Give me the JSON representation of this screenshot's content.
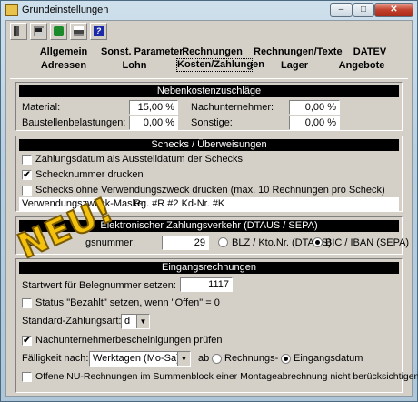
{
  "window": {
    "title": "Grundeinstellungen",
    "min_glyph": "–",
    "max_glyph": "□",
    "close_glyph": "✕"
  },
  "toolbar": {
    "icons": [
      "exit-icon",
      "save-icon",
      "refresh-icon",
      "print-icon",
      "help-icon"
    ],
    "help_glyph": "?"
  },
  "tabs": {
    "row1": [
      "Allgemein",
      "Sonst. Parameter",
      "Rechnungen",
      "Rechnungen/Texte",
      "DATEV"
    ],
    "row2": [
      "Adressen",
      "Lohn",
      "Kosten/Zahlungen",
      "Lager",
      "Angebote"
    ],
    "active": "Kosten/Zahlungen"
  },
  "nebenkosten": {
    "header": "Nebenkostenzuschläge",
    "material_label": "Material:",
    "material_value": "15,00 %",
    "nachunternehmer_label": "Nachunternehmer:",
    "nachunternehmer_value": "0,00 %",
    "baustellen_label": "Baustellenbelastungen:",
    "baustellen_value": "0,00 %",
    "sonstige_label": "Sonstige:",
    "sonstige_value": "0,00 %"
  },
  "schecks": {
    "header": "Schecks / Überweisungen",
    "cb1_label": "Zahlungsdatum als Ausstelldatum der Schecks",
    "cb1_checked": false,
    "cb2_label": "Schecknummer drucken",
    "cb2_checked": true,
    "cb3_label": "Schecks ohne Verwendungszweck drucken (max. 10 Rechnungen pro Scheck)",
    "cb3_checked": false,
    "mask_label": "Verwendungszweck-Maske:",
    "mask_value": "Rg. #R #2 Kd-Nr. #K",
    "check_glyph": "✔"
  },
  "elektronisch": {
    "header": "Elektronischer Zahlungsverkehr (DTAUS / SEPA)",
    "label_part1": "Nä",
    "label_part2": "gsnummer:",
    "value": "29",
    "radio1": "BLZ / Kto.Nr. (DTAUS)",
    "radio2": "BIC / IBAN (SEPA)",
    "selected": "BIC / IBAN (SEPA)",
    "overlay": "NEU!"
  },
  "eingang": {
    "header": "Eingangsrechnungen",
    "startwert_label": "Startwert für Belegnummer setzen:",
    "startwert_value": "1117",
    "status_label": "Status \"Bezahlt\" setzen, wenn \"Offen\" = 0",
    "status_checked": false,
    "standard_label": "Standard-Zahlungsart:",
    "standard_value": "d",
    "nu_label": "Nachunternehmerbescheinigungen prüfen",
    "nu_checked": true,
    "faellig_label": "Fälligkeit nach:",
    "faellig_value": "Werktagen (Mo-Sa)",
    "ab_label": "ab",
    "radio1": "Rechnungs-",
    "radio2": "Eingangsdatum",
    "selected": "Eingangsdatum",
    "offene_label": "Offene NU-Rechnungen im Summenblock einer Montageabrechnung nicht berücksichtigen",
    "offene_checked": false,
    "dropdown_glyph": "▼"
  }
}
